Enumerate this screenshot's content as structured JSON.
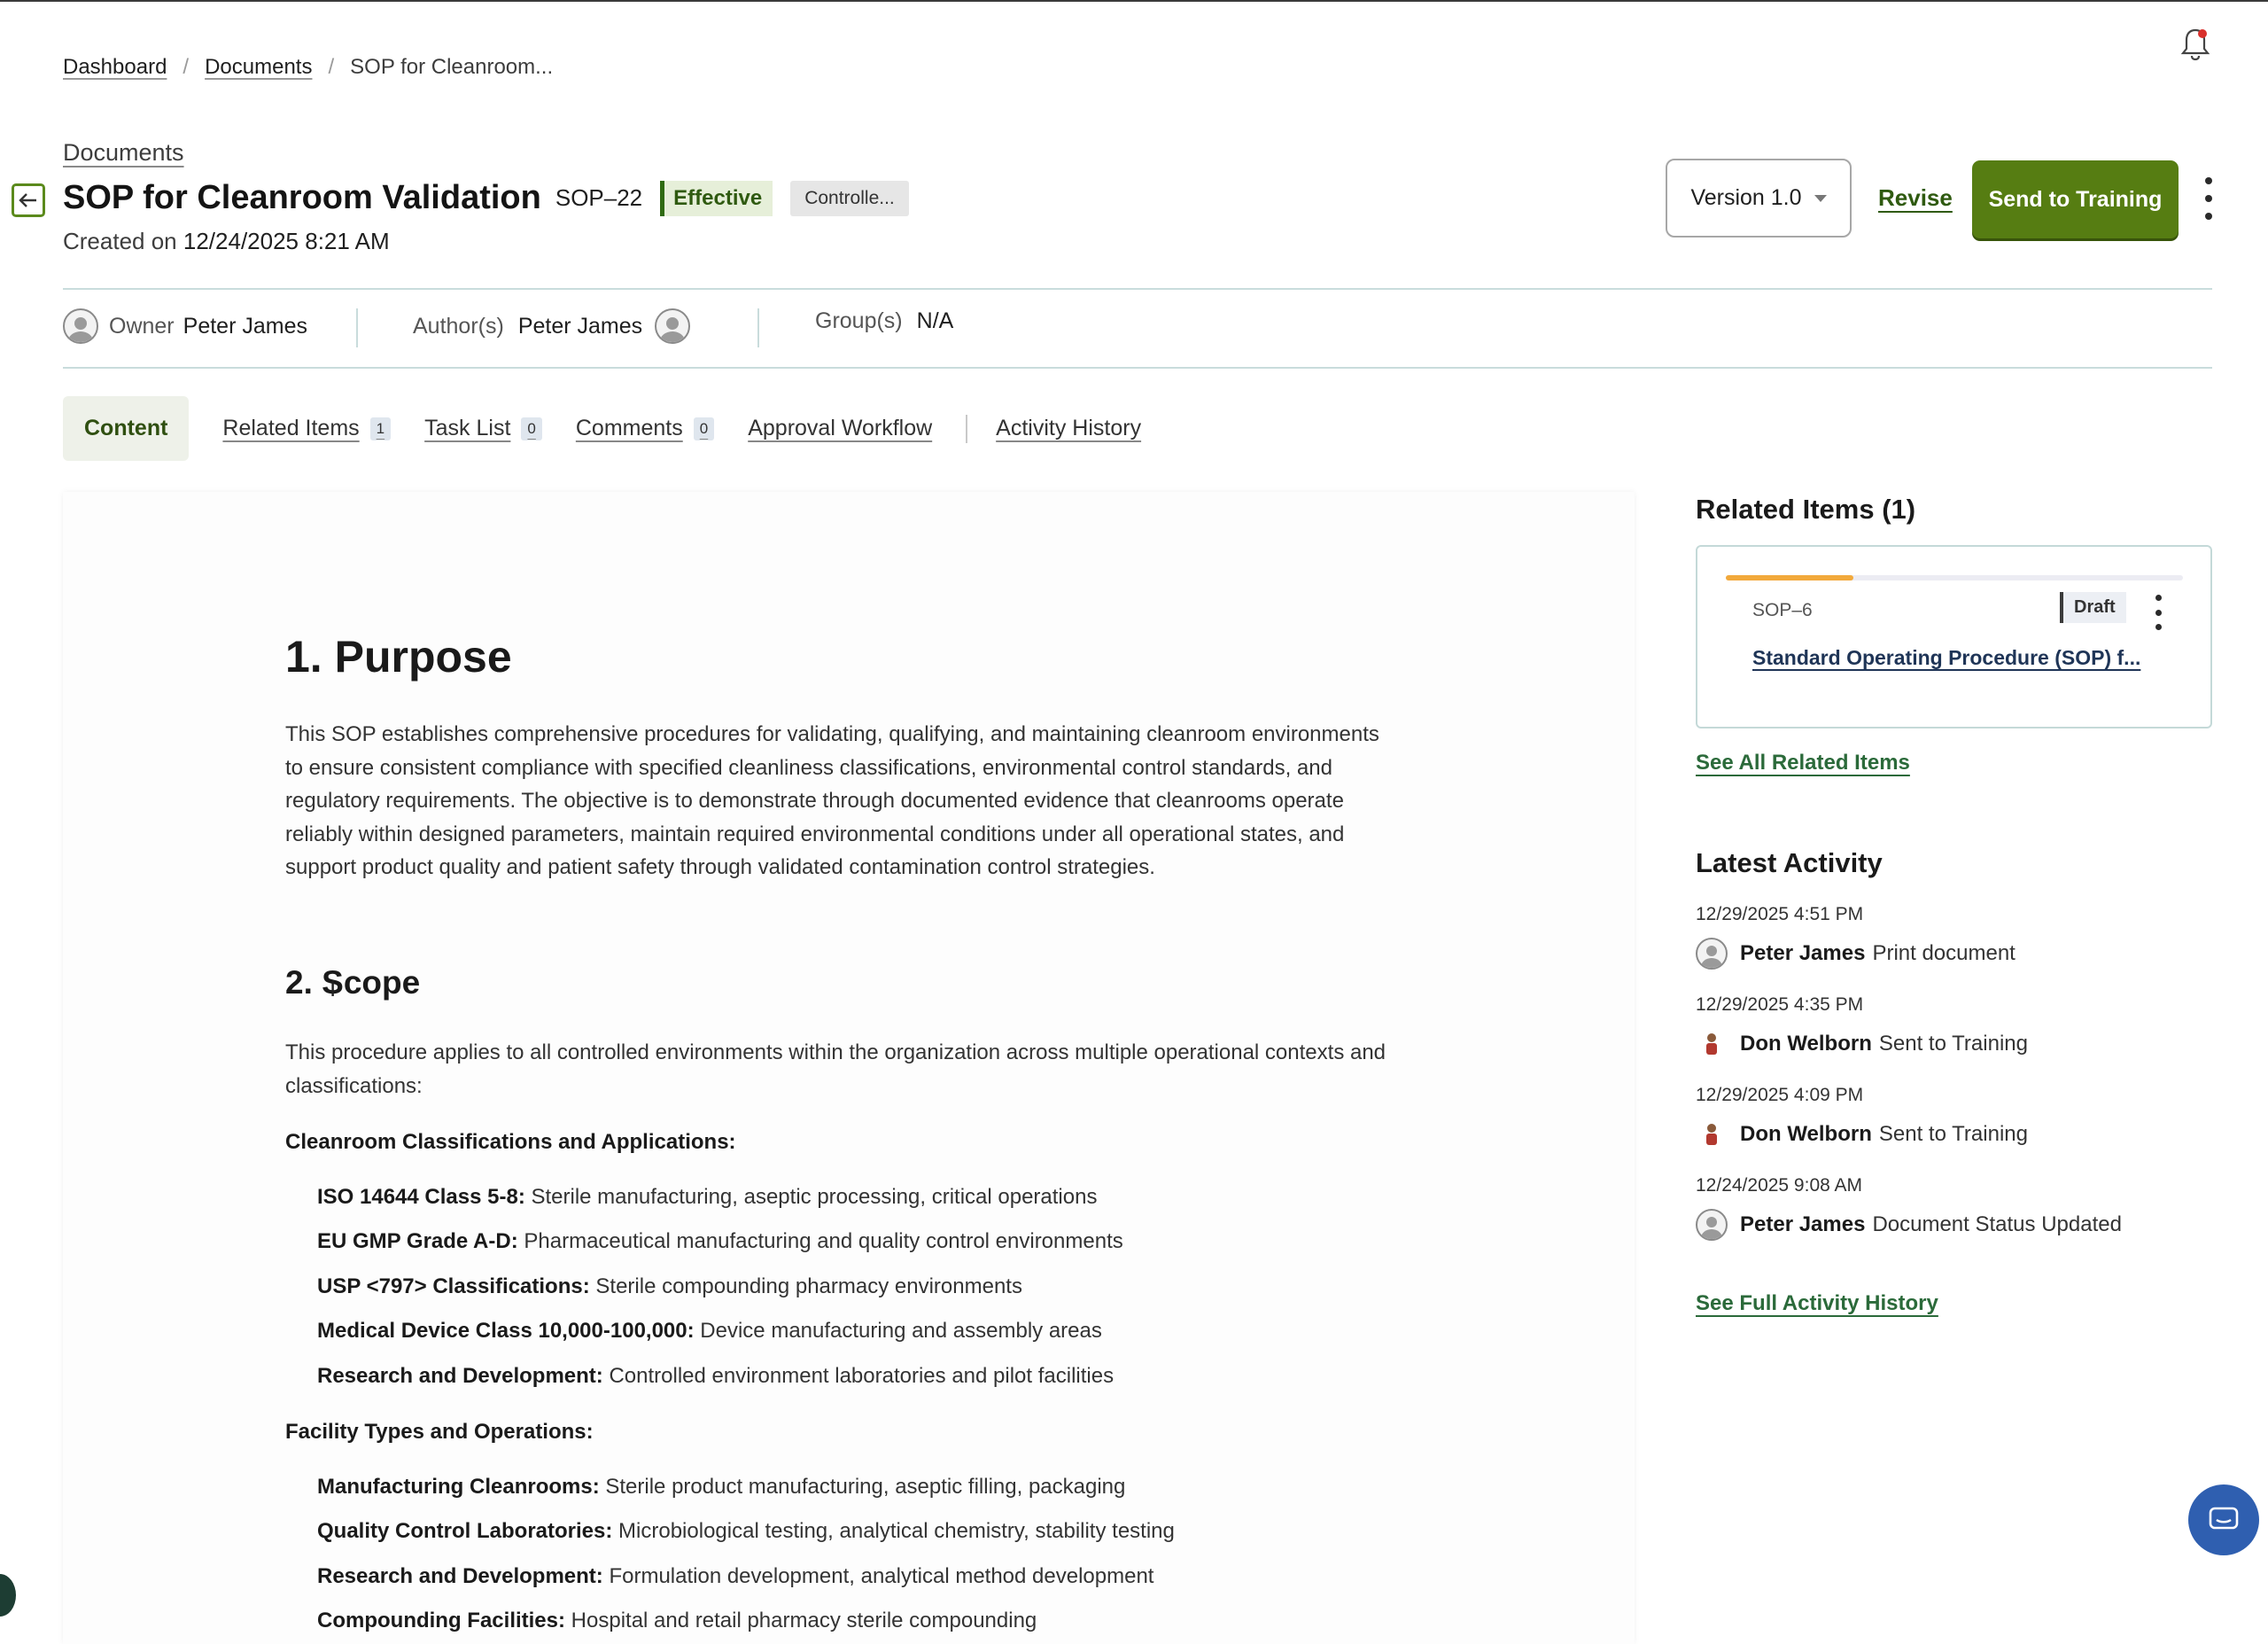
{
  "breadcrumb": {
    "items": [
      "Dashboard",
      "Documents"
    ],
    "current": "SOP for Cleanroom..."
  },
  "header": {
    "documents_link": "Documents",
    "title": "SOP for Cleanroom Validation",
    "doc_id": "SOP–22",
    "status_badge": "Effective",
    "classification_badge": "Controlle...",
    "created_label": "Created on",
    "created_value": "12/24/2025 8:21 AM",
    "version_label": "Version",
    "version_value": "1.0",
    "revise_label": "Revise",
    "send_button": "Send to Training"
  },
  "meta": {
    "owner_label": "Owner",
    "owner_value": "Peter James",
    "authors_label": "Author(s)",
    "authors_value": "Peter James",
    "groups_label": "Group(s)",
    "groups_value": "N/A"
  },
  "tabs": [
    {
      "label": "Content"
    },
    {
      "label": "Related Items",
      "count": "1"
    },
    {
      "label": "Task List",
      "count": "0"
    },
    {
      "label": "Comments",
      "count": "0"
    },
    {
      "label": "Approval Workflow"
    },
    {
      "label": "Activity History"
    }
  ],
  "content": {
    "purpose_heading": "1. Purpose",
    "purpose_text": "This SOP establishes comprehensive procedures for validating, qualifying, and maintaining cleanroom environments to ensure consistent compliance with specified cleanliness classifications, environmental control standards, and regulatory requirements. The objective is to demonstrate through documented evidence that cleanrooms operate reliably within designed parameters, maintain required environmental conditions under all operational states, and support product quality and patient safety through validated contamination control strategies.",
    "scope_heading": "2. Scope",
    "scope_text": "This procedure applies to all controlled environments within the organization across multiple operational contexts and classifications:",
    "classifications_heading": "Cleanroom Classifications and Applications:",
    "classifications": [
      {
        "term": "ISO 14644 Class 5-8:",
        "desc": "Sterile manufacturing, aseptic processing, critical operations"
      },
      {
        "term": "EU GMP Grade A-D:",
        "desc": "Pharmaceutical manufacturing and quality control environments"
      },
      {
        "term": "USP <797> Classifications:",
        "desc": "Sterile compounding pharmacy environments"
      },
      {
        "term": "Medical Device Class 10,000-100,000:",
        "desc": "Device manufacturing and assembly areas"
      },
      {
        "term": "Research and Development:",
        "desc": "Controlled environment laboratories and pilot facilities"
      }
    ],
    "facilities_heading": "Facility Types and Operations:",
    "facilities": [
      {
        "term": "Manufacturing Cleanrooms:",
        "desc": "Sterile product manufacturing, aseptic filling, packaging"
      },
      {
        "term": "Quality Control Laboratories:",
        "desc": "Microbiological testing, analytical chemistry, stability testing"
      },
      {
        "term": "Research and Development:",
        "desc": "Formulation development, analytical method development"
      },
      {
        "term": "Compounding Facilities:",
        "desc": "Hospital and retail pharmacy sterile compounding"
      }
    ]
  },
  "related": {
    "title": "Related Items (1)",
    "card": {
      "id": "SOP–6",
      "status": "Draft",
      "progress": 0.28,
      "link": "Standard Operating Procedure (SOP) f..."
    },
    "see_all": "See All Related Items"
  },
  "activity": {
    "title": "Latest Activity",
    "items": [
      {
        "time": "12/29/2025 4:51 PM",
        "who": "Peter James",
        "action": "Print document"
      },
      {
        "time": "12/29/2025 4:35 PM",
        "who": "Don Welborn",
        "action": "Sent to Training"
      },
      {
        "time": "12/29/2025 4:09 PM",
        "who": "Don Welborn",
        "action": "Sent to Training"
      },
      {
        "time": "12/24/2025 9:08 AM",
        "who": "Peter James",
        "action": "Document Status Updated"
      }
    ],
    "see_full": "See Full Activity History"
  },
  "colors": {
    "accent_green": "#567d12",
    "link_green": "#2b6a3a",
    "draft_progress": "#f2a93b",
    "chat_blue": "#2f5fb0"
  },
  "icons": [
    "bell-icon",
    "back-arrow-icon",
    "chevron-down-icon",
    "kebab-menu-icon",
    "user-avatar-icon",
    "chat-icon"
  ]
}
